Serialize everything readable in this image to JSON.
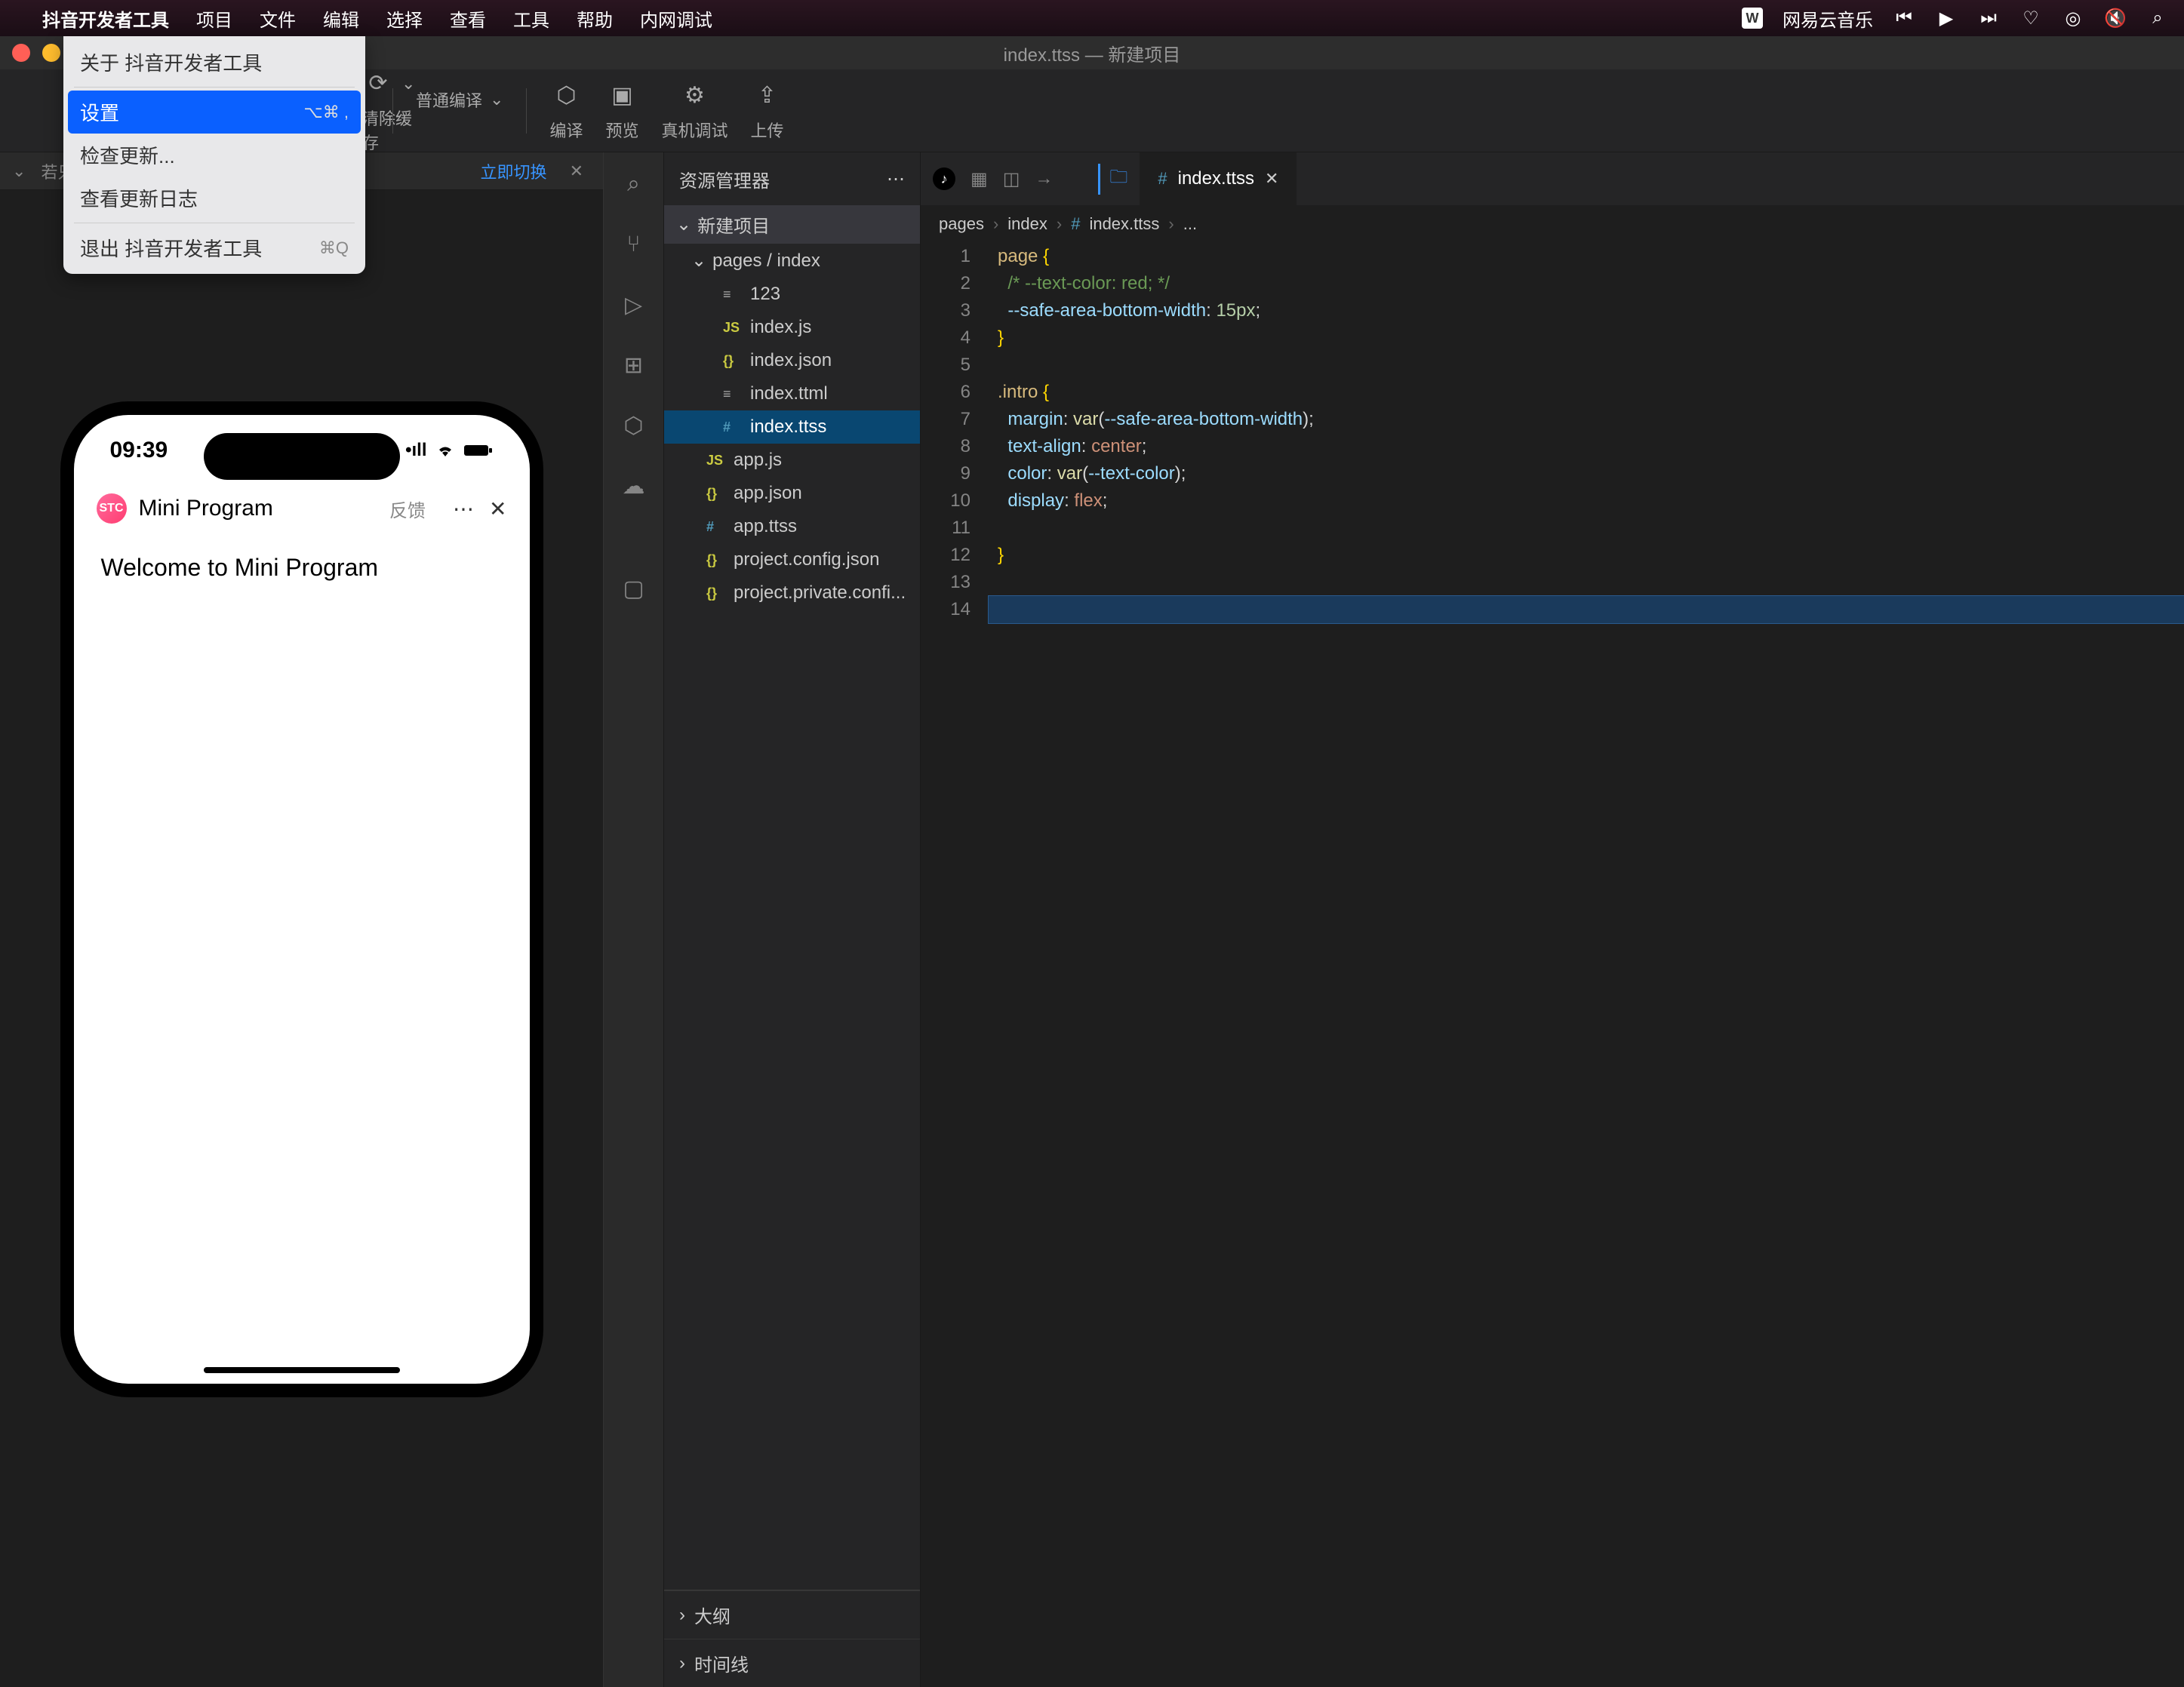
{
  "menubar": {
    "app_name": "抖音开发者工具",
    "items": [
      "项目",
      "文件",
      "编辑",
      "选择",
      "查看",
      "工具",
      "帮助",
      "内网调试"
    ],
    "right_music": "网易云音乐"
  },
  "dropdown": {
    "about": "关于 抖音开发者工具",
    "settings": "设置",
    "settings_shortcut": "⌥⌘ ,",
    "check_update": "检查更新...",
    "view_log": "查看更新日志",
    "quit": "退出 抖音开发者工具",
    "quit_shortcut": "⌘Q"
  },
  "titlebar": {
    "title": "index.ttss — 新建项目"
  },
  "toolbar": {
    "clear_cache": "清除缓存",
    "compile_mode": "普通编译",
    "compile": "编译",
    "preview": "预览",
    "debug": "真机调试",
    "upload": "上传"
  },
  "sub_toolbar": {
    "text_prefix": "若只需要查看行效果…… 可直接 Ctrl 按键",
    "toggle": "立即切换"
  },
  "iphone": {
    "time": "09:39",
    "app_name": "Mini Program",
    "app_icon_text": "STC",
    "feedback": "反馈",
    "welcome": "Welcome to Mini Program"
  },
  "explorer": {
    "header": "资源管理器",
    "root": "新建项目",
    "pages_folder": "pages / index",
    "files": [
      {
        "name": "123",
        "icon": "≡",
        "nested": true
      },
      {
        "name": "index.js",
        "icon": "JS",
        "nested": true
      },
      {
        "name": "index.json",
        "icon": "{}",
        "nested": true
      },
      {
        "name": "index.ttml",
        "icon": "≡",
        "nested": true
      },
      {
        "name": "index.ttss",
        "icon": "#",
        "nested": true,
        "selected": true
      },
      {
        "name": "app.js",
        "icon": "JS",
        "nested": false
      },
      {
        "name": "app.json",
        "icon": "{}",
        "nested": false
      },
      {
        "name": "app.ttss",
        "icon": "#",
        "nested": false
      },
      {
        "name": "project.config.json",
        "icon": "{}",
        "nested": false
      },
      {
        "name": "project.private.confi...",
        "icon": "{}",
        "nested": false
      }
    ],
    "outline": "大纲",
    "timeline": "时间线"
  },
  "editor": {
    "tab_name": "index.ttss",
    "breadcrumbs": [
      "pages",
      "index",
      "index.ttss",
      "..."
    ],
    "code_lines": [
      {
        "n": 1,
        "tokens": [
          [
            "sel",
            "page "
          ],
          [
            "brace",
            "{"
          ]
        ]
      },
      {
        "n": 2,
        "tokens": [
          [
            "",
            "  "
          ],
          [
            "comment",
            "/* --text-color: red; */"
          ]
        ]
      },
      {
        "n": 3,
        "tokens": [
          [
            "",
            "  "
          ],
          [
            "prop",
            "--safe-area-bottom-width"
          ],
          [
            "punct",
            ": "
          ],
          [
            "num",
            "15px"
          ],
          [
            "punct",
            ";"
          ]
        ]
      },
      {
        "n": 4,
        "tokens": [
          [
            "brace",
            "}"
          ]
        ]
      },
      {
        "n": 5,
        "tokens": []
      },
      {
        "n": 6,
        "tokens": [
          [
            "sel",
            ".intro "
          ],
          [
            "brace",
            "{"
          ]
        ]
      },
      {
        "n": 7,
        "tokens": [
          [
            "",
            "  "
          ],
          [
            "prop",
            "margin"
          ],
          [
            "punct",
            ": "
          ],
          [
            "func",
            "var"
          ],
          [
            "punct",
            "("
          ],
          [
            "var",
            "--safe-area-bottom-width"
          ],
          [
            "punct",
            ")"
          ],
          [
            "punct",
            ";"
          ]
        ]
      },
      {
        "n": 8,
        "tokens": [
          [
            "",
            "  "
          ],
          [
            "prop",
            "text-align"
          ],
          [
            "punct",
            ": "
          ],
          [
            "val",
            "center"
          ],
          [
            "punct",
            ";"
          ]
        ]
      },
      {
        "n": 9,
        "tokens": [
          [
            "",
            "  "
          ],
          [
            "prop",
            "color"
          ],
          [
            "punct",
            ": "
          ],
          [
            "func",
            "var"
          ],
          [
            "punct",
            "("
          ],
          [
            "var",
            "--text-color"
          ],
          [
            "punct",
            ")"
          ],
          [
            "punct",
            ";"
          ]
        ]
      },
      {
        "n": 10,
        "tokens": [
          [
            "",
            "  "
          ],
          [
            "prop",
            "display"
          ],
          [
            "punct",
            ": "
          ],
          [
            "val",
            "flex"
          ],
          [
            "punct",
            ";"
          ]
        ]
      },
      {
        "n": 11,
        "tokens": []
      },
      {
        "n": 12,
        "tokens": [
          [
            "brace",
            "}"
          ]
        ]
      },
      {
        "n": 13,
        "tokens": []
      },
      {
        "n": 14,
        "tokens": [],
        "cursor": true
      }
    ]
  }
}
